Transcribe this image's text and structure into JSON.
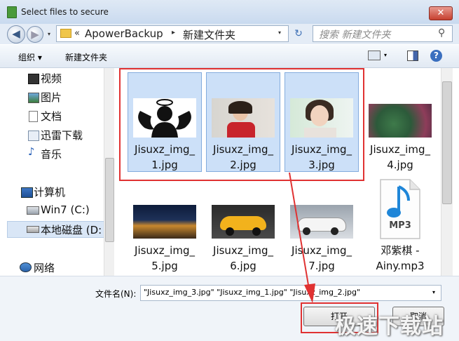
{
  "window": {
    "title": "Select files to secure",
    "close_label": "✕"
  },
  "address": {
    "back": "◀",
    "forward": "▶",
    "breadcrumb_sep": "«",
    "crumb1": "ApowerBackup",
    "crumb_arrow": "▸",
    "crumb2": "新建文件夹",
    "drop": "▾",
    "refresh": "↻"
  },
  "search": {
    "placeholder": "搜索 新建文件夹"
  },
  "toolbar": {
    "organize": "组织 ▾",
    "new_folder": "新建文件夹",
    "help": "?",
    "view_drop": "▾"
  },
  "nav": [
    {
      "label": "视频",
      "icon": "video-icon"
    },
    {
      "label": "图片",
      "icon": "picture-icon"
    },
    {
      "label": "文档",
      "icon": "document-icon"
    },
    {
      "label": "迅雷下载",
      "icon": "download-folder-icon"
    },
    {
      "label": "音乐",
      "icon": "music-icon"
    },
    {
      "label": "计算机",
      "icon": "computer-icon"
    },
    {
      "label": "Win7 (C:)",
      "icon": "drive-icon"
    },
    {
      "label": "本地磁盘 (D:",
      "icon": "drive-icon"
    },
    {
      "label": "网络",
      "icon": "network-icon"
    }
  ],
  "files": [
    {
      "name": "Jisuxz_img_\n1.jpg",
      "selected": true,
      "thumb": "angel-icon"
    },
    {
      "name": "Jisuxz_img_\n2.jpg",
      "selected": true,
      "thumb": "photo-woman-red"
    },
    {
      "name": "Jisuxz_img_\n3.jpg",
      "selected": true,
      "thumb": "photo-woman"
    },
    {
      "name": "Jisuxz_img_\n4.jpg",
      "selected": false,
      "thumb": "photo-forest"
    },
    {
      "name": "Jisuxz_img_\n5.jpg",
      "selected": false,
      "thumb": "photo-castle"
    },
    {
      "name": "Jisuxz_img_\n6.jpg",
      "selected": false,
      "thumb": "photo-car-yellow"
    },
    {
      "name": "Jisuxz_img_\n7.jpg",
      "selected": false,
      "thumb": "photo-car-white"
    },
    {
      "name": "邓紫棋 -\nAiny.mp3",
      "selected": false,
      "thumb": "mp3-icon"
    }
  ],
  "mp3_icon_label": "MP3",
  "filename": {
    "label": "文件名(N):",
    "value": "\"Jisuxz_img_3.jpg\" \"Jisuxz_img_1.jpg\" \"Jisuxz_img_2.jpg\"",
    "drop": "▾"
  },
  "buttons": {
    "open": "打开",
    "cancel": "取消"
  },
  "watermark": "极速下载站",
  "colors": {
    "annotation_red": "#e03232",
    "selection": "#cce0f8",
    "titlebar": "#c9daef"
  }
}
